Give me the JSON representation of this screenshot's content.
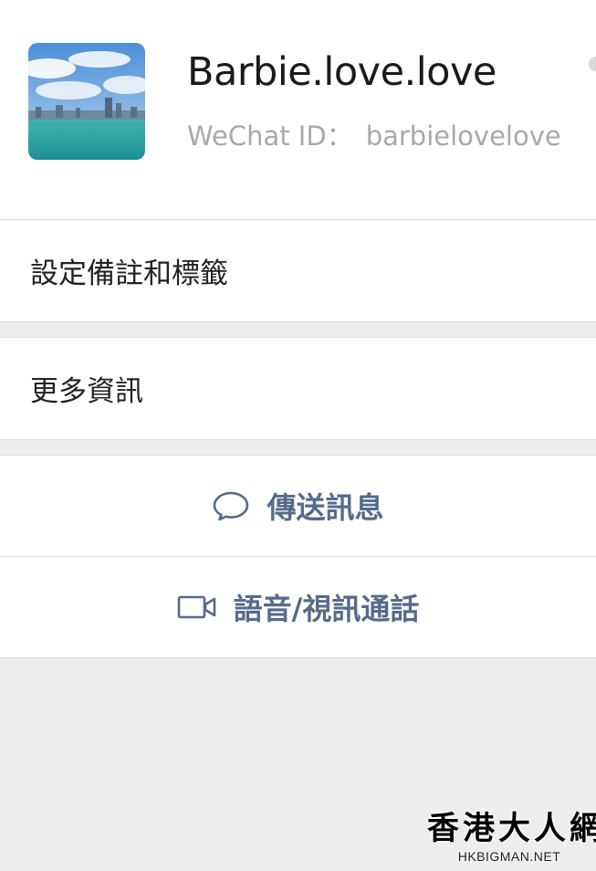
{
  "profile": {
    "nickname": "Barbie.love.love",
    "id_label": "WeChat ID：",
    "id_value": "barbielovelove",
    "avatar": "harbour-skyline-photo"
  },
  "menu": {
    "remarks_tags": "設定備註和標籤",
    "more_info": "更多資訊"
  },
  "actions": {
    "send_message": "傳送訊息",
    "send_message_icon": "chat-bubble-icon",
    "call": "語音/視訊通話",
    "call_icon": "video-camera-icon"
  },
  "watermark": {
    "title": "香港大人網",
    "domain": "HKBIGMAN.NET"
  },
  "colors": {
    "action_text": "#566a8c",
    "background": "#ededed",
    "card": "#ffffff",
    "secondary_text": "#a9a9a9"
  }
}
